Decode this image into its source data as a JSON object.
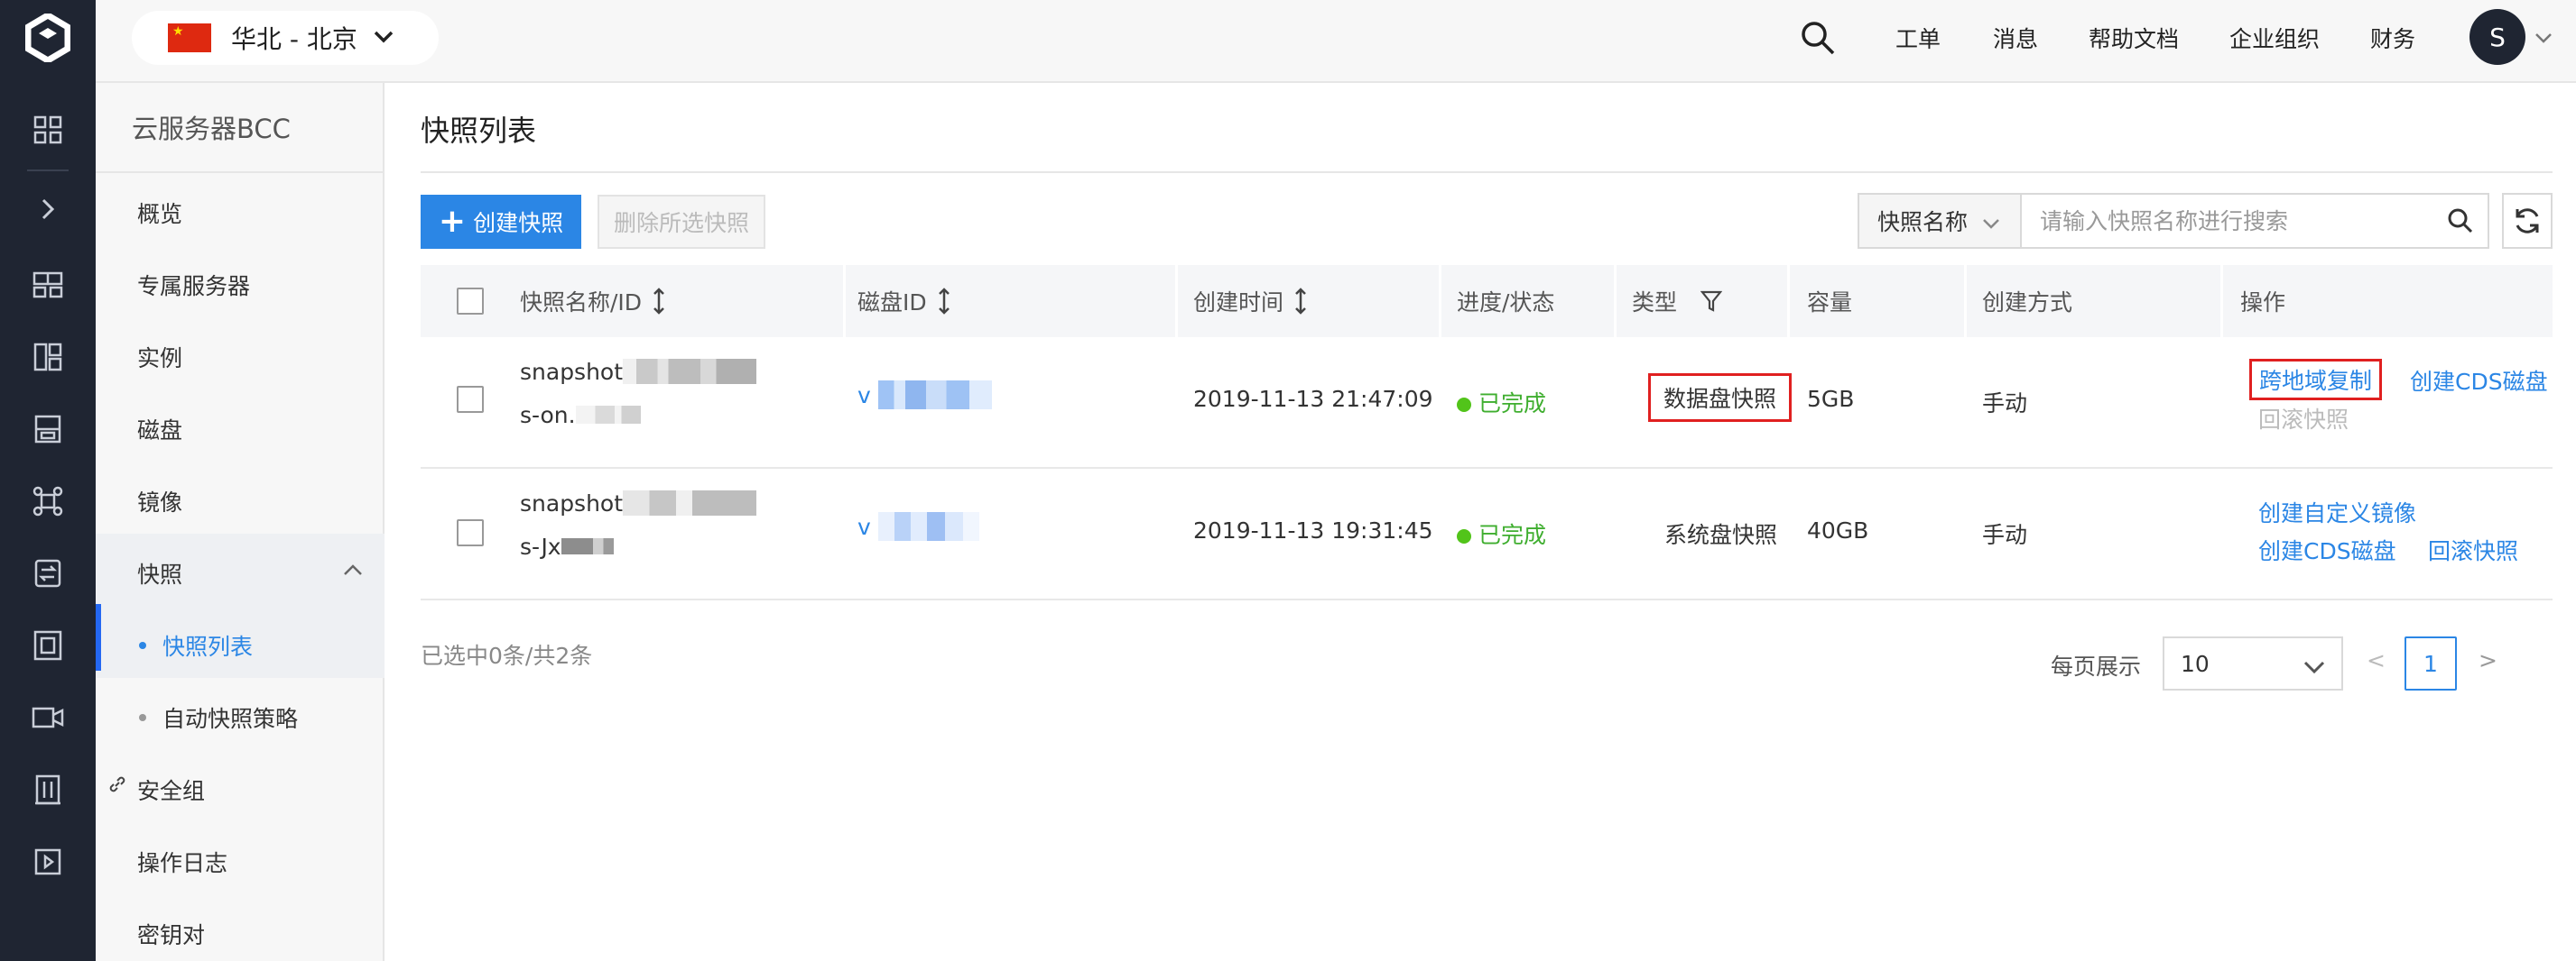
{
  "colors": {
    "brand": "#2b86e5",
    "rail": "#1f2532",
    "success": "#52c41a",
    "highlight": "#e02020"
  },
  "rail": {
    "icons": [
      "logo-icon",
      "grid-icon",
      "expand-icon",
      "dashboard-icon",
      "apps-icon",
      "storage-icon",
      "network-icon",
      "transfer-icon",
      "database-icon",
      "video-icon",
      "building-icon",
      "play-icon"
    ]
  },
  "topbar": {
    "region": "华北 - 北京",
    "nav": [
      "工单",
      "消息",
      "帮助文档",
      "企业组织",
      "财务"
    ],
    "avatar": "S"
  },
  "sidebar": {
    "title": "云服务器BCC",
    "items": [
      "概览",
      "专属服务器",
      "实例",
      "磁盘",
      "镜像",
      "快照",
      "快照列表",
      "自动快照策略",
      "安全组",
      "操作日志",
      "密钥对"
    ]
  },
  "main": {
    "title": "快照列表",
    "create_label": "创建快照",
    "delete_label": "删除所选快照",
    "search": {
      "field": "快照名称",
      "placeholder": "请输入快照名称进行搜索"
    },
    "columns": [
      "快照名称/ID",
      "磁盘ID",
      "创建时间",
      "进度/状态",
      "类型",
      "容量",
      "创建方式",
      "操作"
    ],
    "rows": [
      {
        "name": "snapshot",
        "id": "s-on.",
        "disk": "v",
        "created": "2019-11-13 21:47:09",
        "status": "已完成",
        "type": "数据盘快照",
        "size": "5GB",
        "method": "手动",
        "actions": [
          "跨地域复制",
          "创建CDS磁盘",
          "回滚快照"
        ]
      },
      {
        "name": "snapshot",
        "id": "s-Jx",
        "disk": "v",
        "created": "2019-11-13 19:31:45",
        "status": "已完成",
        "type": "系统盘快照",
        "size": "40GB",
        "method": "手动",
        "actions": [
          "创建自定义镜像",
          "创建CDS磁盘",
          "回滚快照"
        ]
      }
    ],
    "summary": "已选中0条/共2条",
    "pagination": {
      "per_page_label": "每页展示",
      "per_page": "10",
      "prev": "<",
      "current": "1",
      "next": ">"
    }
  }
}
